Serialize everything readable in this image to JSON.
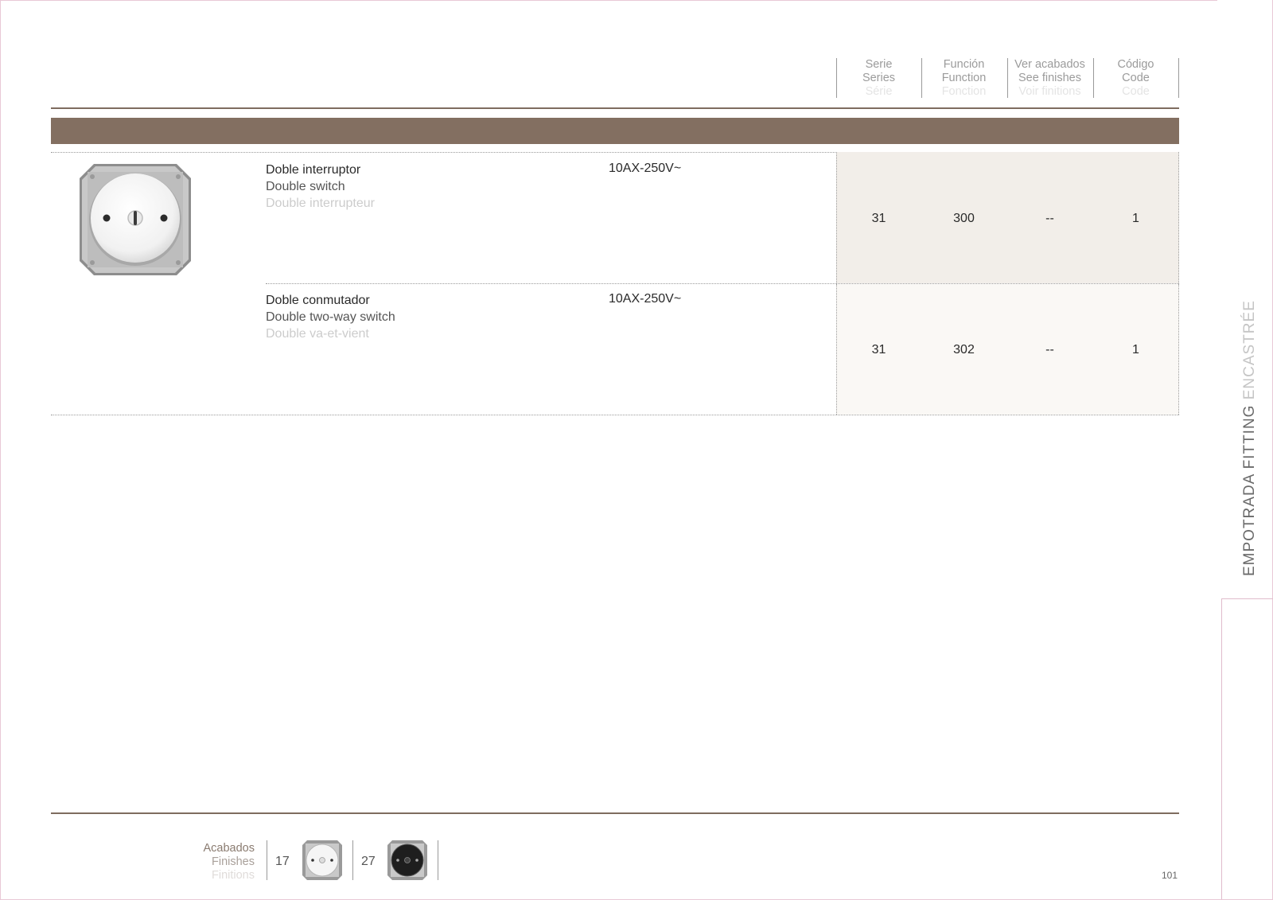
{
  "header": {
    "columns": [
      {
        "es": "Serie",
        "en": "Series",
        "fr": "Série"
      },
      {
        "es": "Función",
        "en": "Function",
        "fr": "Fonction"
      },
      {
        "es": "Ver acabados",
        "en": "See finishes",
        "fr": "Voir finitions"
      },
      {
        "es": "Código",
        "en": "Code",
        "fr": "Code"
      }
    ]
  },
  "products": [
    {
      "name_es": "Doble interruptor",
      "name_en": "Double switch",
      "name_fr": "Double interrupteur",
      "spec": "10AX-250V~",
      "serie": "31",
      "funcion": "300",
      "acabados": "--",
      "codigo": "1"
    },
    {
      "name_es": "Doble conmutador",
      "name_en": "Double two-way switch",
      "name_fr": "Double va-et-vient",
      "spec": "10AX-250V~",
      "serie": "31",
      "funcion": "302",
      "acabados": "--",
      "codigo": "1"
    }
  ],
  "side_title": {
    "dark": "EMPOTRADA FITTING",
    "light": "ENCASTRÉE"
  },
  "finishes": {
    "label_es": "Acabados",
    "label_en": "Finishes",
    "label_fr": "Finitions",
    "items": [
      {
        "code": "17",
        "color": "white"
      },
      {
        "code": "27",
        "color": "black"
      }
    ]
  },
  "page_number": "101",
  "colors": {
    "band": "#836f61",
    "row1_bg": "#f2eee9",
    "row2_bg": "#faf8f5"
  }
}
